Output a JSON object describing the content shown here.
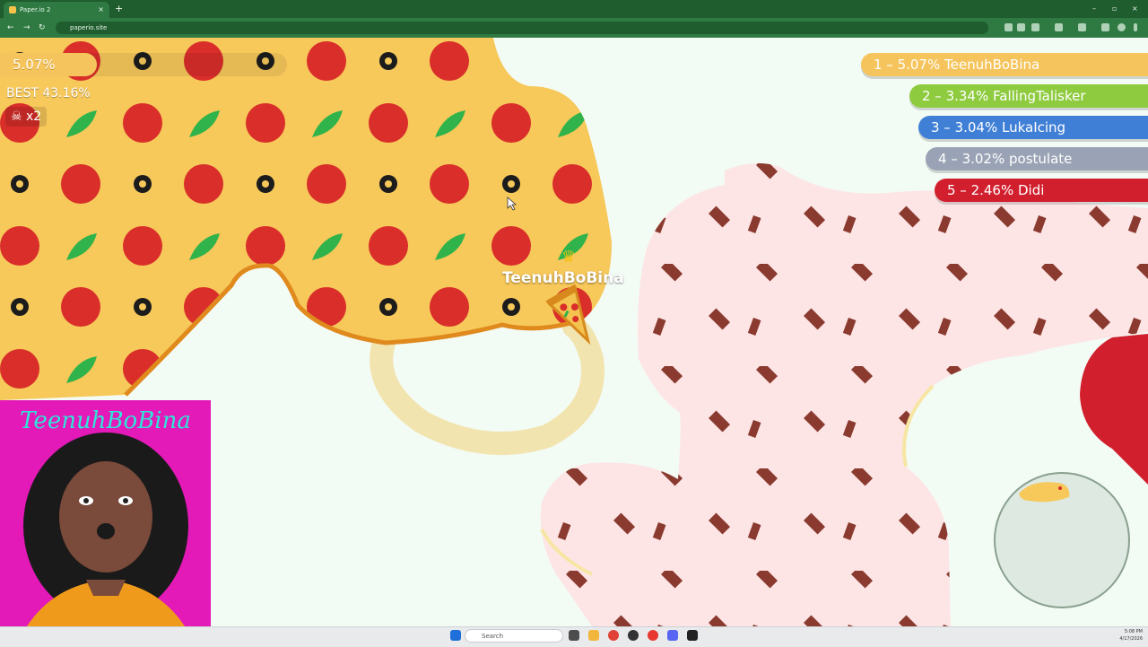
{
  "browser": {
    "tab_title": "Paper.io 2",
    "tab_close": "×",
    "new_tab": "+",
    "url": "paperio.site",
    "nav_back": "←",
    "nav_forward": "→",
    "nav_reload": "↻",
    "win_minimize": "–",
    "win_maximize": "▫",
    "win_close": "×"
  },
  "hud": {
    "percent": "5.07%",
    "percent_value": 5.07,
    "best": "BEST 43.16%",
    "kills": "x2",
    "skull_icon": "skull-icon"
  },
  "leaderboard": [
    {
      "text": "1 – 5.07% TeenuhBoBina",
      "color": "#f5c45c"
    },
    {
      "text": "2 – 3.34% FallingTalisker",
      "color": "#8ecb3f"
    },
    {
      "text": "3 – 3.04% LukaIcing",
      "color": "#3f7fd6"
    },
    {
      "text": "4 – 3.02% postulate",
      "color": "#9aa3b5"
    },
    {
      "text": "5 – 2.46% Didi",
      "color": "#d21f2e"
    }
  ],
  "player": {
    "name": "TeenuhBoBina",
    "crown": "♛",
    "skin": "pizza"
  },
  "webcam": {
    "title": "TeenuhBoBina"
  },
  "taskbar": {
    "search_placeholder": "Search",
    "time": "5:08 PM",
    "date": "4/17/2026"
  },
  "colors": {
    "pizza_territory": "#f7c85a",
    "pizza_edge": "#e08a1e",
    "pepperoni": "#d92e2a",
    "olive": "#1c1c1c",
    "basil": "#2fb34a",
    "chocolate_territory": "#fde5e6",
    "chocolate_chip": "#8a3a2e",
    "trail": "#f1dfa2",
    "red_enemy": "#d21f2e",
    "browser_green": "#2e7a42"
  }
}
